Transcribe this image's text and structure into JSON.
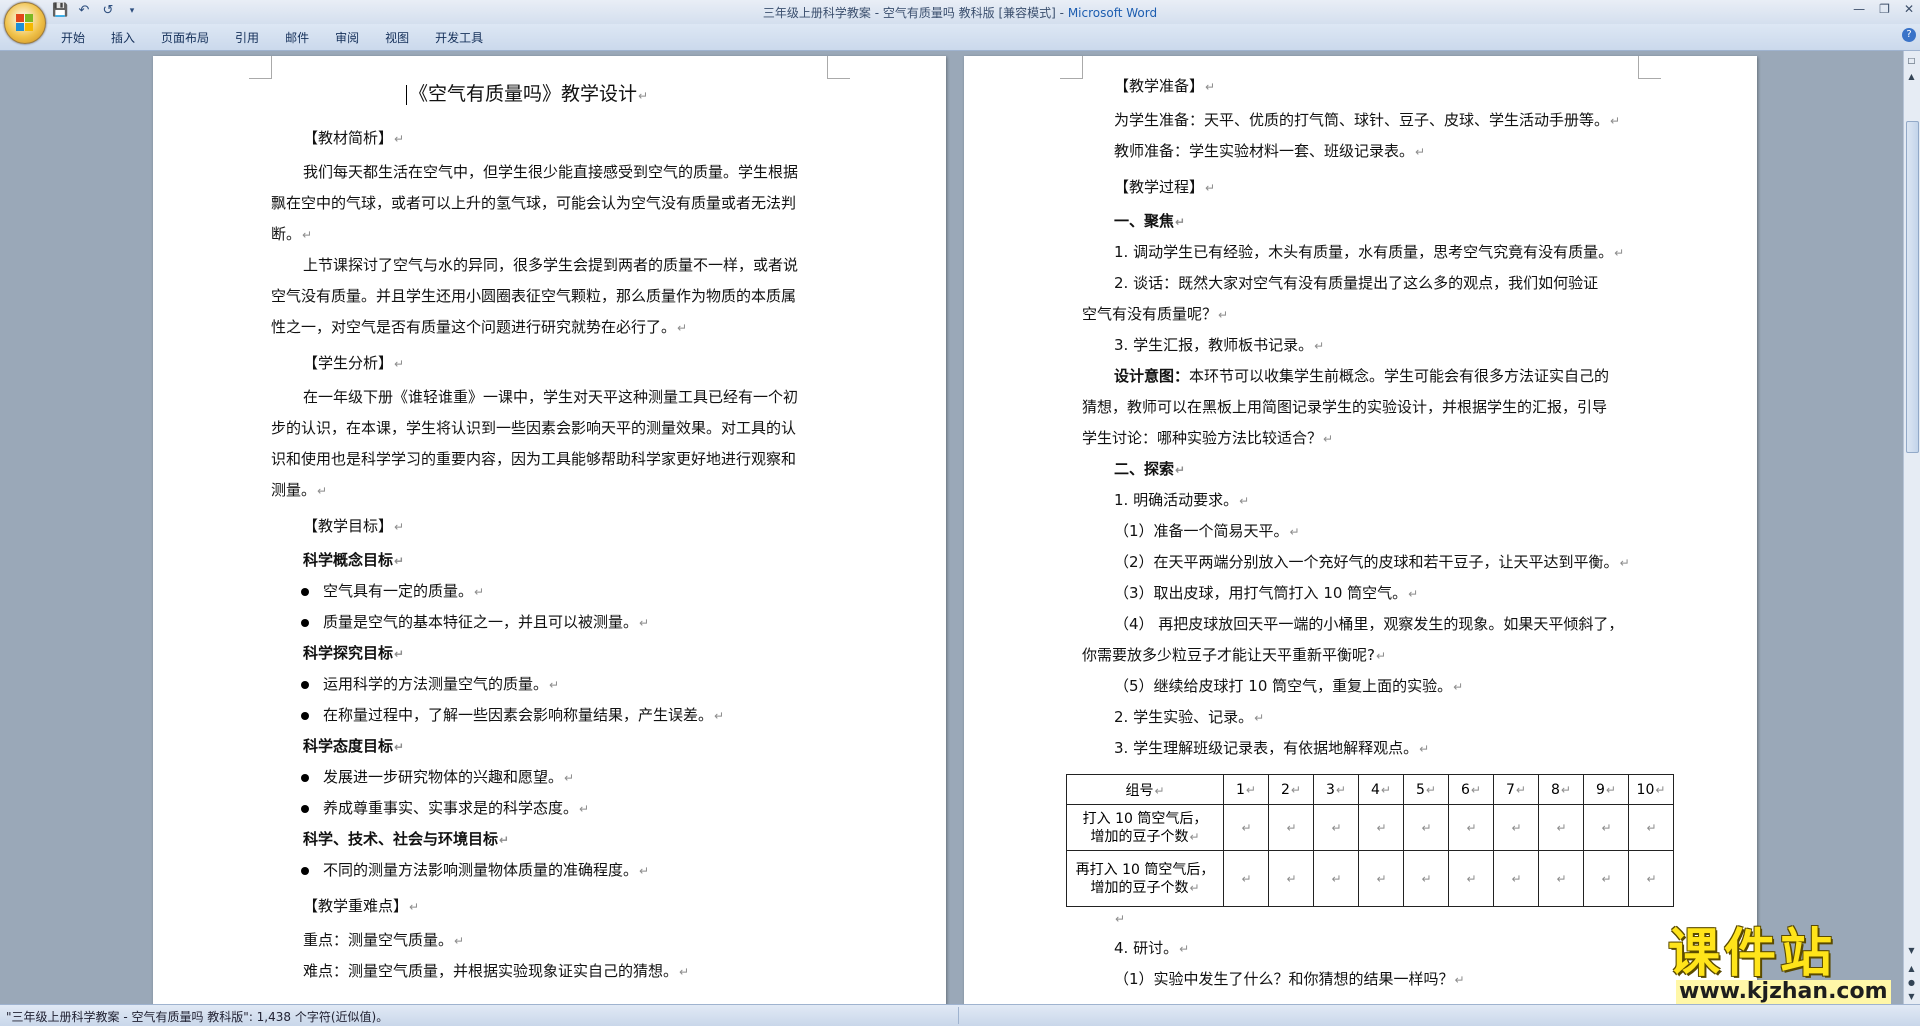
{
  "window": {
    "title_doc": "三年级上册科学教案 - 空气有质量吗 教科版 [兼容模式] - ",
    "title_app": "Microsoft Word"
  },
  "ribbon": {
    "tabs": [
      "开始",
      "插入",
      "页面布局",
      "引用",
      "邮件",
      "审阅",
      "视图",
      "开发工具"
    ]
  },
  "page1": {
    "title": "《空气有质量吗》教学设计",
    "h_material": "【教材简析】",
    "p1": [
      "我们每天都生活在空气中，但学生很少能直接感受到空气的质量。学生根据",
      "飘在空中的气球，或者可以上升的氢气球，可能会认为空气没有质量或者无法判",
      "断。"
    ],
    "p2": [
      "上节课探讨了空气与水的异同，很多学生会提到两者的质量不一样，或者说",
      "空气没有质量。并且学生还用小圆圈表征空气颗粒，那么质量作为物质的本质属",
      "性之一，对空气是否有质量这个问题进行研究就势在必行了。"
    ],
    "h_student": "【学生分析】",
    "p3": [
      "在一年级下册《谁轻谁重》一课中，学生对天平这种测量工具已经有一个初",
      "步的认识，在本课，学生将认识到一些因素会影响天平的测量效果。对工具的认",
      "识和使用也是科学学习的重要内容，因为工具能够帮助科学家更好地进行观察和",
      "测量。"
    ],
    "h_goal": "【教学目标】",
    "g1": "科学概念目标",
    "g1_items": [
      "空气具有一定的质量。",
      "质量是空气的基本特征之一，并且可以被测量。"
    ],
    "g2": "科学探究目标",
    "g2_items": [
      "运用科学的方法测量空气的质量。",
      "在称量过程中，了解一些因素会影响称量结果，产生误差。"
    ],
    "g3": "科学态度目标",
    "g3_items": [
      "发展进一步研究物体的兴趣和愿望。",
      "养成尊重事实、实事求是的科学态度。"
    ],
    "g4": "科学、技术、社会与环境目标",
    "g4_items": [
      "不同的测量方法影响测量物体质量的准确程度。"
    ],
    "h_key": "【教学重难点】",
    "key1": "重点：测量空气质量。",
    "key2": "难点：测量空气质量，并根据实验现象证实自己的猜想。"
  },
  "page2": {
    "h_prep": "【教学准备】",
    "prep1": "为学生准备：天平、优质的打气筒、球针、豆子、皮球、学生活动手册等。",
    "prep2": "教师准备：学生实验材料一套、班级记录表。",
    "h_process": "【教学过程】",
    "s1": "一、聚焦",
    "s1_1": "1. 调动学生已有经验，木头有质量，水有质量，思考空气究竟有没有质量。",
    "s1_2a": "2. 谈话：既然大家对空气有没有质量提出了这么多的观点，我们如何验证",
    "s1_2b": "空气有没有质量呢？",
    "s1_3": "3. 学生汇报，教师板书记录。",
    "design_label": "设计意图：",
    "design_a": "本环节可以收集学生前概念。学生可能会有很多方法证实自己的",
    "design_b": "猜想，教师可以在黑板上用简图记录学生的实验设计，并根据学生的汇报，引导",
    "design_c": "学生讨论：哪种实验方法比较适合？",
    "s2": "二、探索",
    "s2_1": "1. 明确活动要求。",
    "s2_1a": "（1）准备一个简易天平。",
    "s2_1b": "（2）在天平两端分别放入一个充好气的皮球和若干豆子，让天平达到平衡。",
    "s2_1c": "（3）取出皮球，用打气筒打入 10 筒空气。",
    "s2_1d1": "（4） 再把皮球放回天平一端的小桶里，观察发生的现象。如果天平倾斜了，",
    "s2_1d2": "你需要放多少粒豆子才能让天平重新平衡呢?",
    "s2_1e": "（5）继续给皮球打 10 筒空气，重复上面的实验。",
    "s2_2": "2. 学生实验、记录。",
    "s2_3": "3. 学生理解班级记录表，有依据地解释观点。",
    "table": {
      "header_label": "组号",
      "groups": [
        "1",
        "2",
        "3",
        "4",
        "5",
        "6",
        "7",
        "8",
        "9",
        "10"
      ],
      "row1_a": "打入 10 筒空气后，",
      "row1_b": "增加的豆子个数",
      "row2_a": "再打入 10 筒空气后，",
      "row2_b": "增加的豆子个数"
    },
    "s2_4": "4. 研讨。",
    "s2_4a": "（1）实验中发生了什么？和你猜想的结果一样吗？"
  },
  "status": {
    "text": "\"三年级上册科学教案 - 空气有质量吗 教科版\": 1,438 个字符(近似值)。"
  },
  "watermark": {
    "big": "课件站",
    "small": "www.kjzhan.com"
  },
  "marks": {
    "paragraph": "↵"
  }
}
